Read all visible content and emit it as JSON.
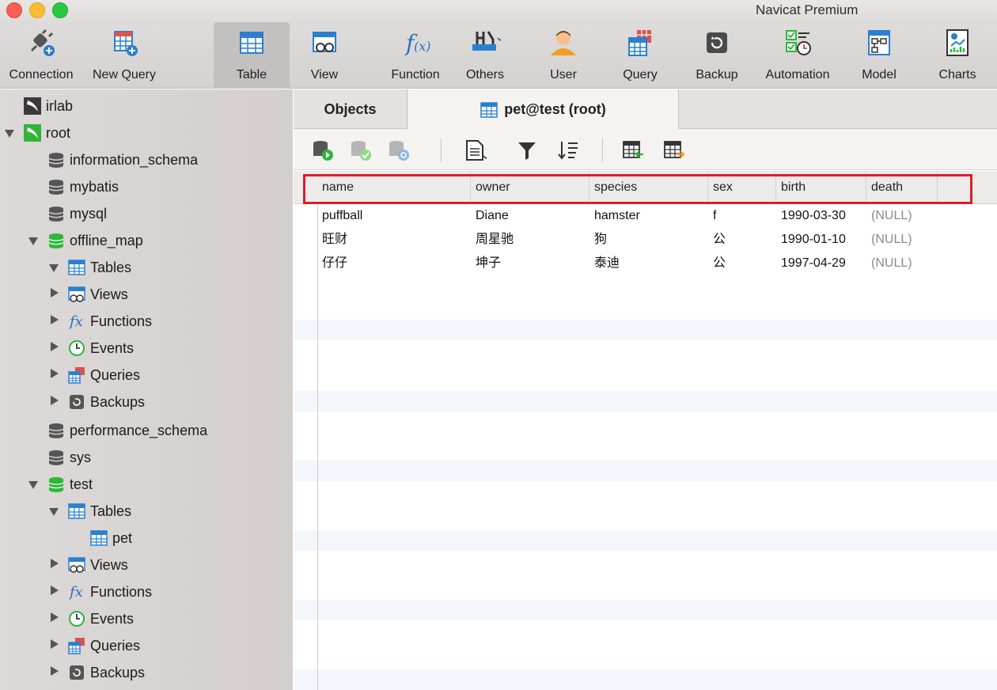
{
  "window": {
    "title": "Navicat Premium"
  },
  "toolbar": {
    "items": [
      {
        "label": "Connection",
        "icon": "plug-plus-icon"
      },
      {
        "label": "New Query",
        "icon": "new-query-icon"
      },
      {
        "label": "Table",
        "icon": "table-icon",
        "active": true
      },
      {
        "label": "View",
        "icon": "view-icon"
      },
      {
        "label": "Function",
        "icon": "function-icon"
      },
      {
        "label": "Others",
        "icon": "tools-icon"
      },
      {
        "label": "User",
        "icon": "user-icon"
      },
      {
        "label": "Query",
        "icon": "query-icon"
      },
      {
        "label": "Backup",
        "icon": "backup-icon"
      },
      {
        "label": "Automation",
        "icon": "automation-icon"
      },
      {
        "label": "Model",
        "icon": "model-icon"
      },
      {
        "label": "Charts",
        "icon": "charts-icon"
      }
    ]
  },
  "sidebar": {
    "items": [
      {
        "label": "irlab",
        "icon": "connection-icon"
      },
      {
        "label": "root",
        "icon": "connection-icon",
        "expanded": true
      },
      {
        "label": "information_schema",
        "icon": "database-icon"
      },
      {
        "label": "mybatis",
        "icon": "database-icon"
      },
      {
        "label": "mysql",
        "icon": "database-icon"
      },
      {
        "label": "offline_map",
        "icon": "database-icon",
        "expanded": true
      },
      {
        "label": "Tables",
        "icon": "table-icon",
        "expanded": true
      },
      {
        "label": "Views",
        "icon": "view-icon"
      },
      {
        "label": "Functions",
        "icon": "function-icon"
      },
      {
        "label": "Events",
        "icon": "clock-icon"
      },
      {
        "label": "Queries",
        "icon": "query-icon"
      },
      {
        "label": "Backups",
        "icon": "backup-icon"
      },
      {
        "label": "performance_schema",
        "icon": "database-icon"
      },
      {
        "label": "sys",
        "icon": "database-icon"
      },
      {
        "label": "test",
        "icon": "database-icon",
        "expanded": true
      },
      {
        "label": "Tables",
        "icon": "table-icon",
        "expanded": true
      },
      {
        "label": "pet",
        "icon": "table-icon"
      },
      {
        "label": "Views",
        "icon": "view-icon"
      },
      {
        "label": "Functions",
        "icon": "function-icon"
      },
      {
        "label": "Events",
        "icon": "clock-icon"
      },
      {
        "label": "Queries",
        "icon": "query-icon"
      },
      {
        "label": "Backups",
        "icon": "backup-icon"
      }
    ]
  },
  "tabs": [
    {
      "label": "Objects"
    },
    {
      "label": "pet@test (root)",
      "icon": "table-icon",
      "active": true
    }
  ],
  "grid": {
    "columns": [
      "name",
      "owner",
      "species",
      "sex",
      "birth",
      "death"
    ],
    "rows": [
      [
        "puffball",
        "Diane",
        "hamster",
        "f",
        "1990-03-30",
        "(NULL)"
      ],
      [
        "旺财",
        "周星驰",
        "狗",
        "公",
        "1990-01-10",
        "(NULL)"
      ],
      [
        "仔仔",
        "坤子",
        "泰迪",
        "公",
        "1997-04-29",
        "(NULL)"
      ]
    ]
  },
  "colors": {
    "highlight": "#d81e2c",
    "accent": "#2a7fd0",
    "green": "#2fb53a"
  }
}
